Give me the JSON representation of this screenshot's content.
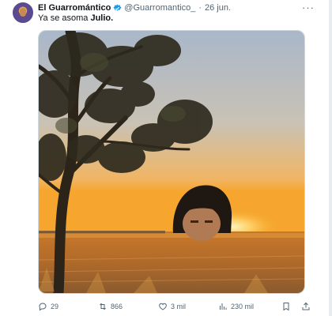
{
  "tweet": {
    "author_name": "El Guarromántico",
    "handle": "@Guarromantico_",
    "separator": "·",
    "date": "26 jun.",
    "text_prefix": "Ya se asoma",
    "text_bold": "Julio.",
    "more_label": "···"
  },
  "actions": {
    "replies": "29",
    "retweets": "866",
    "likes": "3 mil",
    "views": "230 mil"
  },
  "colors": {
    "verified": "#1d9bf0",
    "muted": "#536471",
    "sky_top": "#9fb3cc",
    "horizon": "#f2a33a"
  }
}
